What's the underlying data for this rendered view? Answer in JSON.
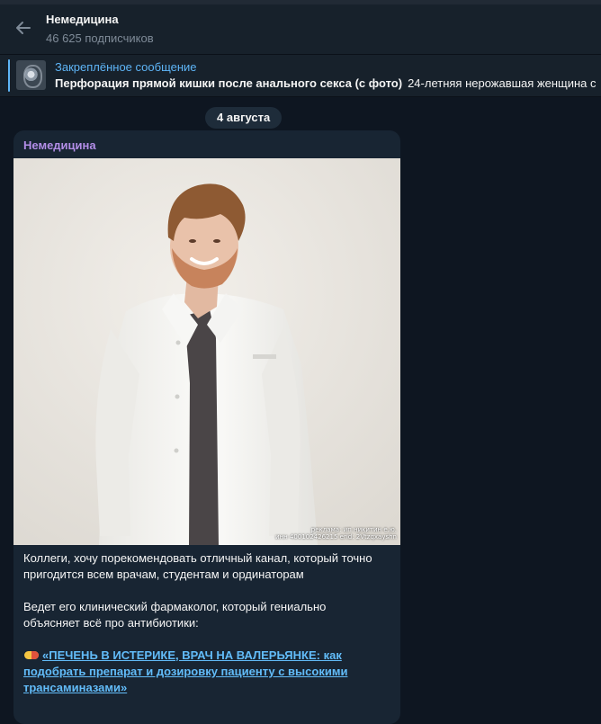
{
  "window": {
    "topbar_color": "#212a35"
  },
  "header": {
    "back_icon": "arrow-left-icon",
    "title": "Немедицина",
    "subscribers": "46 625 подписчиков"
  },
  "pinned": {
    "label": "Закреплённое сообщение",
    "title": "Перфорация прямой кишки после анального секса (с фото)",
    "preview": "24-летняя нерожавшая женщина с",
    "thumbnail": "x-ray-thumbnail"
  },
  "date_badge": "4 августа",
  "message": {
    "sender": "Немедицина",
    "sender_color": "#b38ee8",
    "ad_note_line1": "реклама: ип никитин е.ю.",
    "ad_note_line2": "инн 400102426215 erid: 2Vtzqxayshn",
    "paragraph1": "Коллеги, хочу порекомендовать отличный канал, который точно пригодится всем врачам, студентам и ординаторам",
    "paragraph2": "Ведет его клинический фармаколог, который гениально объясняет всё про антибиотики:",
    "link1": "«ПЕЧЕНЬ В ИСТЕРИКЕ, ВРАЧ НА ВАЛЕРЬЯНКЕ: как подобрать препарат и дозировку пациенту с высокими трансаминазами»",
    "link_icon": "pill-icon",
    "link_color": "#62bcf9"
  },
  "colors": {
    "background": "#0e1621",
    "header": "#17212b",
    "bubble": "#182533",
    "accent": "#5eb5f7"
  }
}
